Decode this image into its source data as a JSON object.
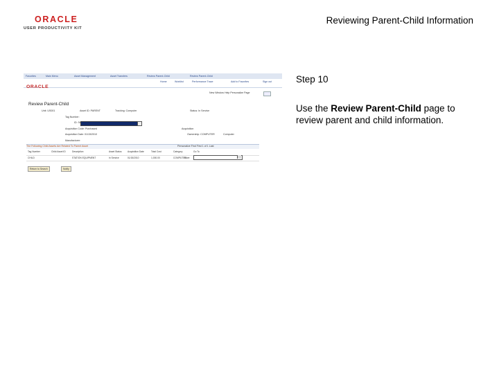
{
  "header": {
    "logo_brand": "ORACLE",
    "logo_tagline": "USER PRODUCTIVITY KIT",
    "doc_title": "Reviewing Parent-Child Information"
  },
  "step": {
    "heading": "Step 10",
    "desc_prefix": "Use the ",
    "desc_bold": "Review Parent-Child",
    "desc_suffix": " page to review parent and child information."
  },
  "screenshot": {
    "top_tabs": [
      "Favorites",
      "Main Menu",
      "Asset Management",
      "Asset Transfers",
      "Review Parent-Child",
      "Review Parent-Child"
    ],
    "brand": "ORACLE",
    "nav_links": [
      "Home",
      "Worklist",
      "Performance Trace",
      "Add to Favorites",
      "Sign out"
    ],
    "utils": "New Window  Help  Personalize Page",
    "page_title": "Review Parent-Child",
    "labels": [
      "Unit: US001",
      "Asset ID: PARENT",
      "Tracking: Computer",
      "Status: In Service",
      "Tag Number:",
      "ID: Serial",
      "Acquisition Code: Purchased",
      "Acquisition",
      "Acquisition Date: 01/15/2010",
      "Ownership: COMPUTER",
      "Computer",
      "Manufacturer:"
    ],
    "grid_title": "The Following Child Assets Are Related To Parent Asset",
    "grid_nav": "Personalize  Find  First  1 of 1  Last",
    "columns": [
      "Tag Number",
      "Child Asset ID",
      "Description",
      "Asset Status",
      "Acquisition Date",
      "Total Cost",
      "Category",
      "Go To"
    ],
    "row": [
      "CHILD",
      "STATION EQUIPMENT",
      "In Service",
      "01/15/2010",
      "1,000.00",
      "COMPUTER",
      "More"
    ],
    "buttons": [
      "Return to Search",
      "Notify"
    ]
  }
}
